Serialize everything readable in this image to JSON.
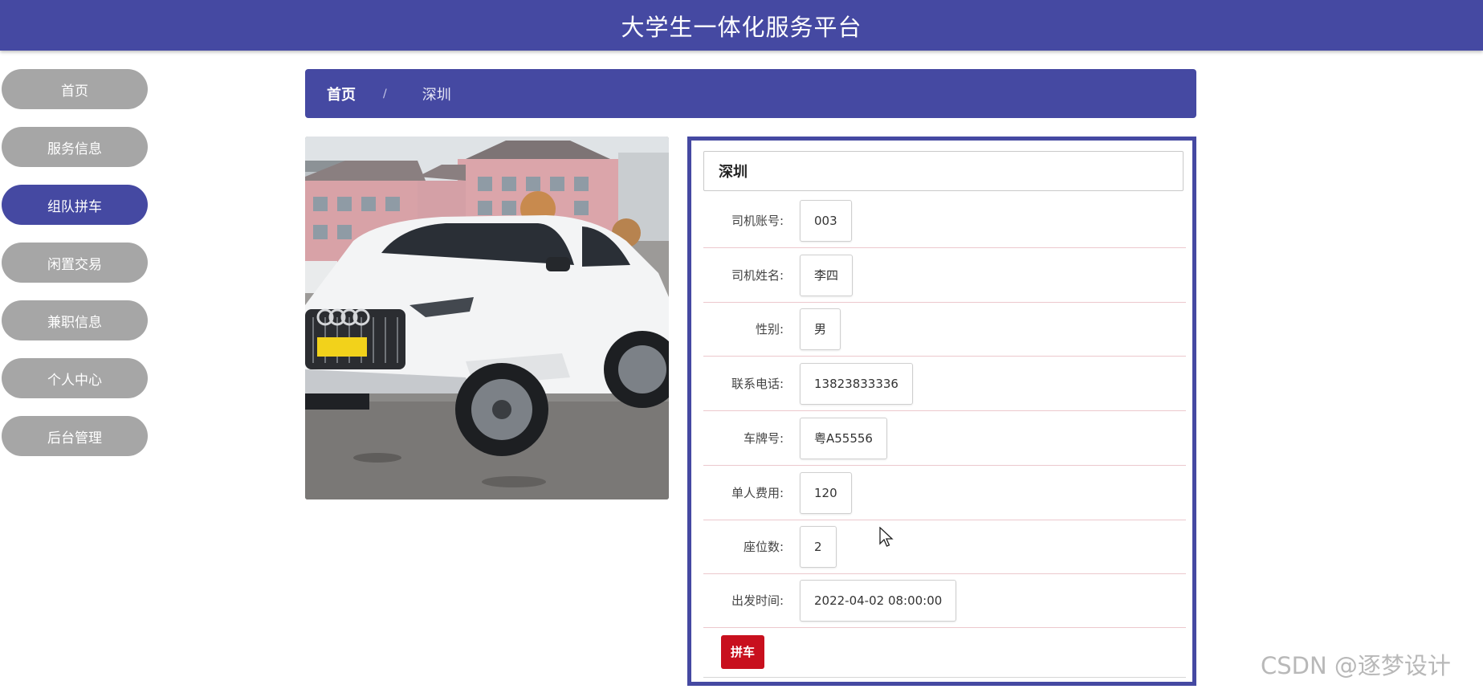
{
  "header": {
    "title": "大学生一体化服务平台"
  },
  "sidebar": {
    "items": [
      {
        "label": "首页",
        "active": false
      },
      {
        "label": "服务信息",
        "active": false
      },
      {
        "label": "组队拼车",
        "active": true
      },
      {
        "label": "闲置交易",
        "active": false
      },
      {
        "label": "兼职信息",
        "active": false
      },
      {
        "label": "个人中心",
        "active": false
      },
      {
        "label": "后台管理",
        "active": false
      }
    ]
  },
  "breadcrumb": {
    "home": "首页",
    "separator": "/",
    "current": "深圳"
  },
  "detail": {
    "title": "深圳",
    "fields": [
      {
        "label": "司机账号:",
        "value": "003"
      },
      {
        "label": "司机姓名:",
        "value": "李四"
      },
      {
        "label": "性别:",
        "value": "男"
      },
      {
        "label": "联系电话:",
        "value": "13823833336"
      },
      {
        "label": "车牌号:",
        "value": "粤A55556"
      },
      {
        "label": "单人费用:",
        "value": "120"
      },
      {
        "label": "座位数:",
        "value": "2"
      },
      {
        "label": "出发时间:",
        "value": "2022-04-02 08:00:00"
      }
    ],
    "action_label": "拼车"
  },
  "watermark": "CSDN @逐梦设计",
  "colors": {
    "primary": "#4549a2",
    "nav_inactive": "#a6a6a6",
    "action": "#c8101e"
  },
  "icons": {
    "cursor": "mouse-pointer-icon"
  }
}
